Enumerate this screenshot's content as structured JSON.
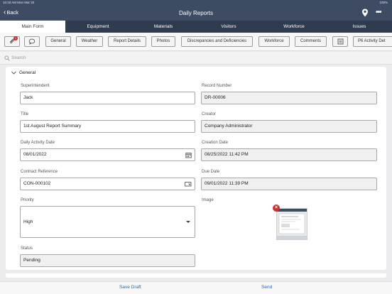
{
  "status_bar": {
    "time_date": "10:18 AM  Mon Mar 20",
    "battery": "100%"
  },
  "nav": {
    "back_label": "Back",
    "title": "Daily Reports"
  },
  "tabs": [
    {
      "label": "Main Form",
      "active": true
    },
    {
      "label": "Equipment"
    },
    {
      "label": "Materials"
    },
    {
      "label": "Visitors"
    },
    {
      "label": "Workforce"
    },
    {
      "label": "Issues"
    }
  ],
  "chips": {
    "attachment_count": "1",
    "items": [
      "General",
      "Weather",
      "Report Details",
      "Photos",
      "Discrepancies and Deficiencies",
      "Workforce",
      "Comments",
      "P6 Activity Det"
    ]
  },
  "search": {
    "placeholder": "Search"
  },
  "section": {
    "title": "General"
  },
  "fields": {
    "superintendent": {
      "label": "Superintendent",
      "value": "Jack"
    },
    "record_number": {
      "label": "Record Number",
      "value": "DR-00006"
    },
    "title": {
      "label": "Title",
      "value": "1st August Report Summary"
    },
    "creator": {
      "label": "Creator",
      "value": "Company Administrator"
    },
    "daily_activity_date": {
      "label": "Daily Activity Date",
      "value": "08/01/2022"
    },
    "creation_date": {
      "label": "Creation Date",
      "value": "08/25/2022 11:42 PM"
    },
    "contract_reference": {
      "label": "Contract Reference",
      "value": "CON-000102"
    },
    "due_date": {
      "label": "Due Date",
      "value": "09/01/2022 11:39 PM"
    },
    "priority": {
      "label": "Priority",
      "value": "High"
    },
    "image": {
      "label": "Image"
    },
    "status": {
      "label": "Status",
      "value": "Pending"
    }
  },
  "footer": {
    "save_draft": "Save Draft",
    "send": "Send"
  },
  "colors": {
    "navbar": "#3d4c63",
    "tabbar": "#2f3b4f",
    "accent_link": "#2e67b1",
    "badge": "#c52a2a"
  },
  "icons": [
    "back-chevron-icon",
    "location-pin-icon",
    "more-icon",
    "attachment-icon",
    "comment-icon",
    "list-icon",
    "search-icon",
    "collapse-chevron-icon",
    "calendar-icon",
    "lookup-icon",
    "dropdown-caret-icon",
    "remove-image-icon"
  ]
}
